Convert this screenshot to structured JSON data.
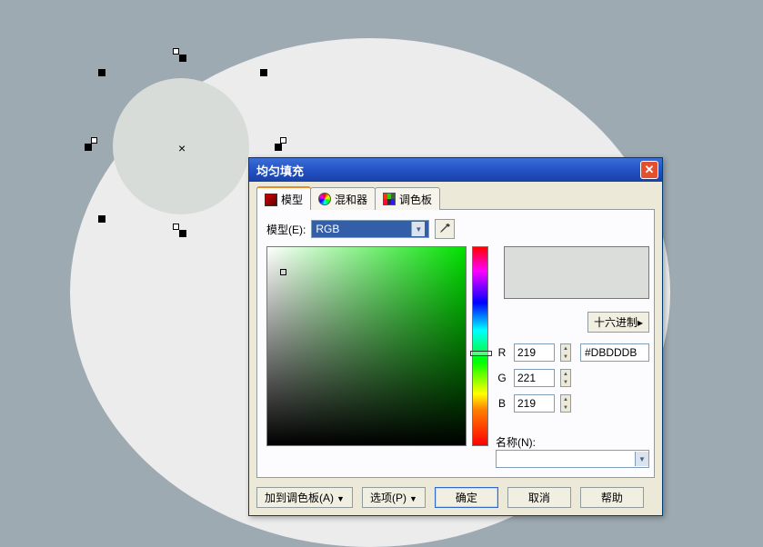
{
  "dialog": {
    "title": "均匀填充",
    "tabs": {
      "model": "模型",
      "mixer": "混和器",
      "palette": "调色板"
    },
    "model_label": "模型(E):",
    "model_value": "RGB",
    "hex_button": "十六进制▸",
    "channels": {
      "r_label": "R",
      "r_value": "219",
      "g_label": "G",
      "g_value": "221",
      "b_label": "B",
      "b_value": "219"
    },
    "hex_value": "#DBDDDB",
    "name_label": "名称(N):",
    "name_value": "",
    "buttons": {
      "add_palette": "加到调色板(A)",
      "options": "选项(P)",
      "ok": "确定",
      "cancel": "取消",
      "help": "帮助"
    }
  },
  "colors": {
    "preview": "#dbdddb"
  }
}
